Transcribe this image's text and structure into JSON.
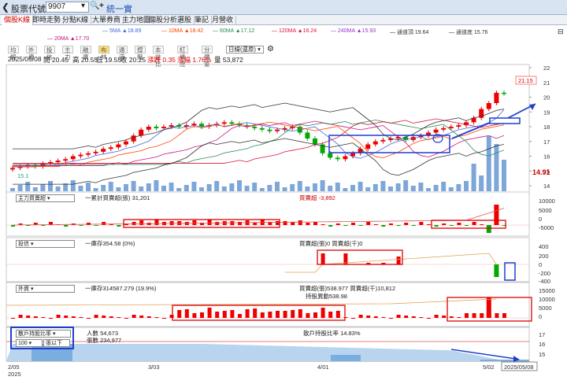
{
  "header": {
    "back_icon": "chevron-left-icon",
    "stock_label": "股票代號",
    "symbol": "9907",
    "name": "統一實"
  },
  "tabs": [
    "個股K線",
    "即時走勢",
    "分點K線",
    "大單券商",
    "主力地圖",
    "個股分析",
    "選股",
    "筆記",
    "月營收"
  ],
  "ma_legend": [
    {
      "label": "5MA ▲18.89",
      "color": "#4169e1"
    },
    {
      "label": "10MA ▲18.42",
      "color": "#ff4500"
    },
    {
      "label": "60MA ▲17.12",
      "color": "#2e8b57"
    },
    {
      "label": "120MA ▲16.24",
      "color": "#dc143c"
    },
    {
      "label": "240MA ▲15.93",
      "color": "#9932cc"
    },
    {
      "label": "通道頂 19.64",
      "color": "#333333"
    },
    {
      "label": "通道底 15.76",
      "color": "#333333"
    },
    {
      "label": "20MA ▲17.70",
      "color": "#c71585"
    }
  ],
  "chart_buttons": [
    "均線",
    "外資",
    "投信",
    "主力",
    "融資",
    "布林",
    "通道",
    "撐壓",
    "本益比",
    "紅綠燈",
    "分價量"
  ],
  "active_button": "布林",
  "period_select": "日線(還原)",
  "quote": {
    "date": "2025/05/08",
    "open": "開 20.45",
    "high": "高 20.55",
    "low": "低 19.55",
    "close": "收 20.25",
    "change": "漲跌 0.35",
    "pct": "漲幅 1.76%",
    "volume": "量 53,872"
  },
  "price_axis": [
    "22",
    "21",
    "20",
    "19",
    "18",
    "17",
    "16",
    "15",
    "14"
  ],
  "price_tags": {
    "last": "21.15",
    "low": "14.91",
    "low_tag": "15.1"
  },
  "panes": {
    "main_force": {
      "select": "主力買賣超",
      "legend_left": "一累計買賣超(張) 31,201",
      "legend_right": "買賣超 -3,892",
      "axis": [
        "10000",
        "5000",
        "0",
        "-5000"
      ]
    },
    "trust": {
      "select": "投信",
      "legend_left": "一庫存354.58 (0%)",
      "legend_right": "買賣超(張)0 買賣超(千)0",
      "axis": [
        "400",
        "200",
        "0",
        "-200",
        "-400"
      ]
    },
    "foreign": {
      "select": "外資",
      "legend_left": "一庫存314587.279 (19.9%)",
      "legend_right": "買賣超(張)538.977 買賣超(千)10,812",
      "legend_right2": "持股異動538.98",
      "axis": [
        "15000",
        "10000",
        "5000",
        "0"
      ]
    },
    "retail": {
      "select": "散戶持股比率",
      "input": "100",
      "unit_select": "張以下",
      "legend_left": "人數 54,673",
      "legend_left2": "張數 234,977",
      "legend_right": "散戶持股比率 14.83%",
      "axis": [
        "17",
        "16",
        "15"
      ]
    }
  },
  "date_axis": [
    "2/05\n2025",
    "3/03",
    "4/01",
    "5/02",
    "2025/05/08"
  ],
  "chart_data": {
    "type": "candlestick",
    "x_range": [
      "2025/02/05",
      "2025/05/08"
    ],
    "ylim": [
      14,
      22
    ],
    "last_close": 20.25,
    "last_high": 21.15
  }
}
